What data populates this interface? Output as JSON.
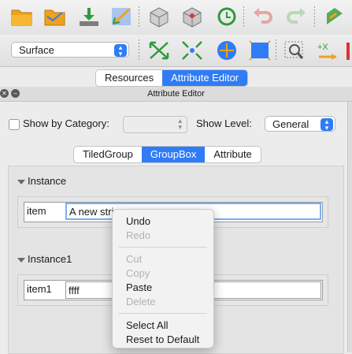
{
  "toolbar": {
    "row1_icons": [
      "folder-open-icon",
      "folder-icon",
      "download-icon",
      "expand-arrows-icon",
      "cube-3d-icon",
      "cube-3d-alt-icon",
      "refresh-icon",
      "undo-icon",
      "redo-icon",
      "partial-icon"
    ],
    "surface_select": "Surface",
    "row2_icons": [
      "collapse-arrows-icon",
      "contract-arrows-icon",
      "move-icon",
      "cube-blue-icon",
      "zoom-fit-icon",
      "plus-x-axis-icon"
    ]
  },
  "top_tabs": [
    "Resources",
    "Attribute Editor"
  ],
  "panel": {
    "title": "Attribute Editor",
    "show_by_category_label": "Show by Category:",
    "show_level_label": "Show Level:",
    "show_level_value": "General"
  },
  "sub_tabs": [
    "TiledGroup",
    "GroupBox",
    "Attribute"
  ],
  "instances": [
    {
      "header": "Instance",
      "item_label": "item",
      "item_value": "A new stri"
    },
    {
      "header": "Instance1",
      "item_label": "item1",
      "item_value": "ffff"
    }
  ],
  "context_menu": {
    "items": [
      {
        "label": "Undo",
        "enabled": true
      },
      {
        "label": "Redo",
        "enabled": false
      },
      {
        "label": "Cut",
        "enabled": false
      },
      {
        "label": "Copy",
        "enabled": false
      },
      {
        "label": "Paste",
        "enabled": true
      },
      {
        "label": "Delete",
        "enabled": false
      },
      {
        "label": "Select All",
        "enabled": true
      },
      {
        "label": "Reset to Default",
        "enabled": true
      }
    ]
  },
  "colors": {
    "accent": "#2f7cf6",
    "folder": "#f0a21c",
    "green": "#2f9a3a",
    "blue": "#2f7cf6"
  }
}
